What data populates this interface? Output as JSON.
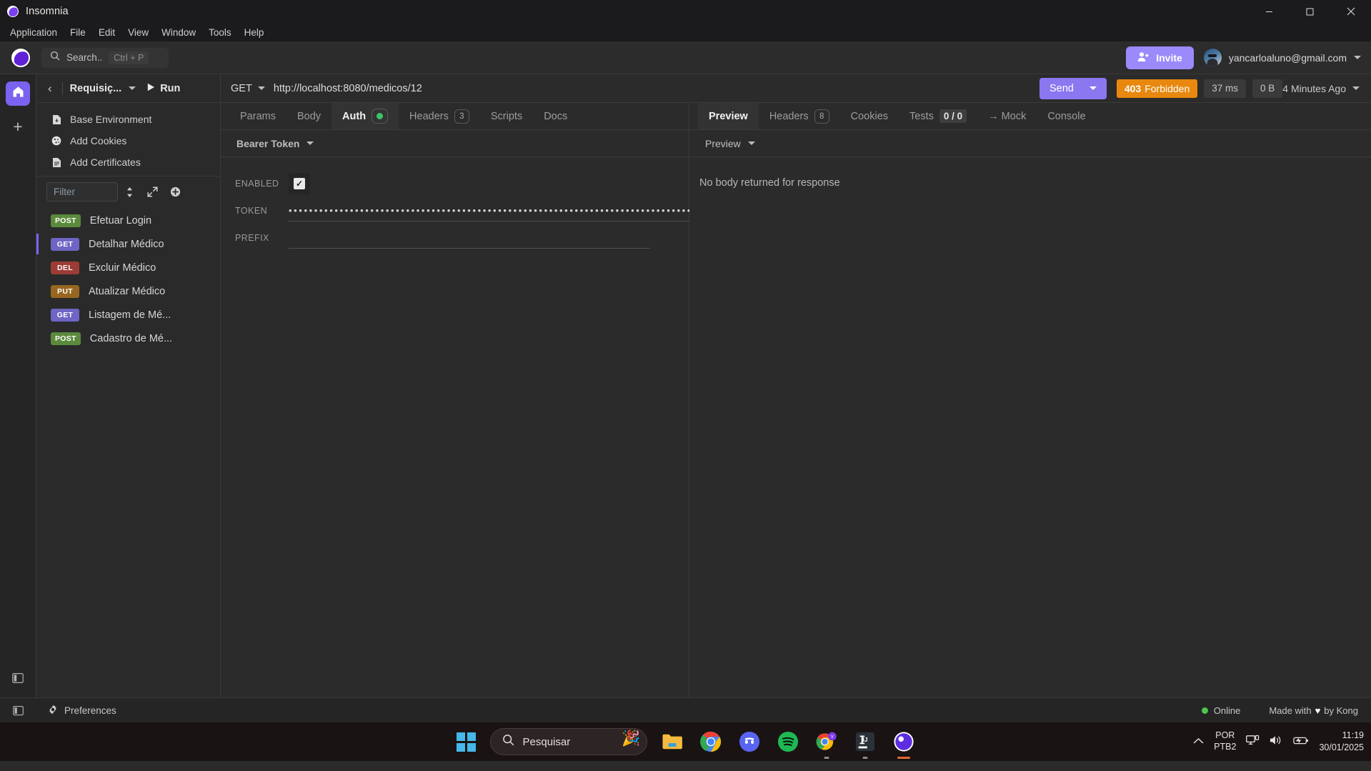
{
  "titlebar": {
    "app_name": "Insomnia",
    "minimize": "minimize-icon",
    "maximize": "maximize-icon",
    "close": "close-icon"
  },
  "menubar": {
    "items": [
      {
        "label": "Application"
      },
      {
        "label": "File"
      },
      {
        "label": "Edit"
      },
      {
        "label": "View"
      },
      {
        "label": "Window"
      },
      {
        "label": "Tools"
      },
      {
        "label": "Help"
      }
    ]
  },
  "toolbar": {
    "search_placeholder": "Search..",
    "search_shortcut": "Ctrl + P",
    "invite_label": "Invite",
    "account_email": "yancarloaluno@gmail.com"
  },
  "sidebar": {
    "request_group_name": "Requisiç...",
    "run_label": "Run",
    "env_items": [
      {
        "label": "Base Environment",
        "icon": "environment-file-icon"
      },
      {
        "label": "Add Cookies",
        "icon": "cookie-icon"
      },
      {
        "label": "Add Certificates",
        "icon": "certificate-icon"
      }
    ],
    "filter_placeholder": "Filter",
    "requests": [
      {
        "method": "POST",
        "label": "Efetuar Login",
        "active": false
      },
      {
        "method": "GET",
        "label": "Detalhar Médico",
        "active": true
      },
      {
        "method": "DEL",
        "label": "Excluir Médico",
        "active": false
      },
      {
        "method": "PUT",
        "label": "Atualizar Médico",
        "active": false
      },
      {
        "method": "GET",
        "label": "Listagem de Mé...",
        "active": false
      },
      {
        "method": "POST",
        "label": "Cadastro de Mé...",
        "active": false
      }
    ]
  },
  "request": {
    "method": "GET",
    "url": "http://localhost:8080/medicos/12",
    "send_label": "Send",
    "tabs": [
      {
        "label": "Params",
        "badge": null,
        "active": false
      },
      {
        "label": "Body",
        "badge": null,
        "active": false
      },
      {
        "label": "Auth",
        "badge": "dot",
        "active": true
      },
      {
        "label": "Headers",
        "badge": "3",
        "active": false
      },
      {
        "label": "Scripts",
        "badge": null,
        "active": false
      },
      {
        "label": "Docs",
        "badge": null,
        "active": false
      }
    ],
    "auth": {
      "type_label": "Bearer Token",
      "enabled_label": "ENABLED",
      "enabled_value": true,
      "token_label": "TOKEN",
      "token_value": "••••••••••••••••••••••••••••••••••••••••••••••••••••••••••••••••••••••••••••••••••••••••••••••••••••••••••••••••••••••••••",
      "prefix_label": "PREFIX",
      "prefix_value": ""
    }
  },
  "response": {
    "status_code": "403",
    "status_text": "Forbidden",
    "time": "37 ms",
    "size": "0 B",
    "time_ago": "4 Minutes Ago",
    "tabs": [
      {
        "label": "Preview",
        "badge": null,
        "active": true
      },
      {
        "label": "Headers",
        "badge": "8",
        "active": false
      },
      {
        "label": "Cookies",
        "badge": null,
        "active": false
      },
      {
        "label": "Tests",
        "badge": "0 / 0",
        "active": false
      },
      {
        "label": "→ Mock",
        "badge": null,
        "active": false
      },
      {
        "label": "Console",
        "badge": null,
        "active": false
      }
    ],
    "view_mode": "Preview",
    "empty_message": "No body returned for response"
  },
  "statusbar": {
    "preferences_label": "Preferences",
    "online_label": "Online",
    "credit_prefix": "Made with",
    "credit_suffix": "by Kong",
    "heart": "♥"
  },
  "taskbar": {
    "search_placeholder": "Pesquisar",
    "apps": [
      {
        "name": "file-explorer-icon"
      },
      {
        "name": "chrome-icon"
      },
      {
        "name": "discord-icon"
      },
      {
        "name": "spotify-icon"
      },
      {
        "name": "chrome-profile-icon"
      },
      {
        "name": "intellij-idea-icon"
      },
      {
        "name": "insomnia-icon"
      }
    ],
    "language_line1": "POR",
    "language_line2": "PTB2",
    "time": "11:19",
    "date": "30/01/2025"
  },
  "colors": {
    "accent": "#7c62f0",
    "send": "#8b77f0",
    "status_warning": "#e8880e",
    "online_green": "#4ec54e",
    "method_post": "#5b8a3c",
    "method_get": "#6e65c4",
    "method_del": "#9c3c34",
    "method_put": "#97661f"
  }
}
